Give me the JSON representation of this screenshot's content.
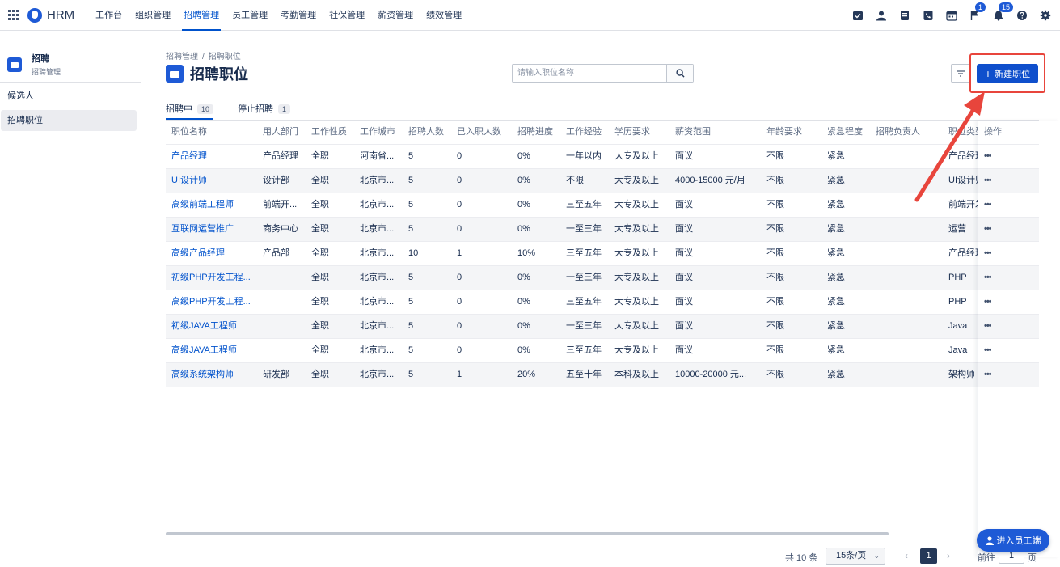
{
  "app": {
    "name": "HRM"
  },
  "nav": {
    "items": [
      "工作台",
      "组织管理",
      "招聘管理",
      "员工管理",
      "考勤管理",
      "社保管理",
      "薪资管理",
      "绩效管理"
    ],
    "active": "招聘管理"
  },
  "top_icons": [
    {
      "name": "task-icon"
    },
    {
      "name": "user-icon"
    },
    {
      "name": "document-icon"
    },
    {
      "name": "phone-icon"
    },
    {
      "name": "calendar-icon"
    },
    {
      "name": "flag-icon",
      "badge": "1"
    },
    {
      "name": "bell-icon",
      "badge": "15"
    },
    {
      "name": "help-icon"
    },
    {
      "name": "settings-icon"
    }
  ],
  "sidebar": {
    "title": "招聘",
    "subtitle": "招聘管理",
    "items": [
      {
        "label": "候选人",
        "active": false
      },
      {
        "label": "招聘职位",
        "active": true
      }
    ]
  },
  "breadcrumb": [
    "招聘管理",
    "招聘职位"
  ],
  "page_title": "招聘职位",
  "search": {
    "placeholder": "请输入职位名称",
    "value": ""
  },
  "new_button": "新建职位",
  "tabs": [
    {
      "label": "招聘中",
      "count": "10",
      "active": true
    },
    {
      "label": "停止招聘",
      "count": "1",
      "active": false
    }
  ],
  "table": {
    "columns": [
      "职位名称",
      "用人部门",
      "工作性质",
      "工作城市",
      "招聘人数",
      "已入职人数",
      "招聘进度",
      "工作经验",
      "学历要求",
      "薪资范围",
      "年龄要求",
      "紧急程度",
      "招聘负责人",
      "职位类型",
      "操作"
    ],
    "rows": [
      [
        "产品经理",
        "产品经理",
        "全职",
        "河南省...",
        "5",
        "0",
        "0%",
        "一年以内",
        "大专及以上",
        "面议",
        "不限",
        "紧急",
        "",
        "产品经理"
      ],
      [
        "UI设计师",
        "设计部",
        "全职",
        "北京市...",
        "5",
        "0",
        "0%",
        "不限",
        "大专及以上",
        "4000-15000 元/月",
        "不限",
        "紧急",
        "",
        "UI设计师"
      ],
      [
        "高级前端工程师",
        "前端开...",
        "全职",
        "北京市...",
        "5",
        "0",
        "0%",
        "三至五年",
        "大专及以上",
        "面议",
        "不限",
        "紧急",
        "",
        "前端开发"
      ],
      [
        "互联网运营推广",
        "商务中心",
        "全职",
        "北京市...",
        "5",
        "0",
        "0%",
        "一至三年",
        "大专及以上",
        "面议",
        "不限",
        "紧急",
        "",
        "运营"
      ],
      [
        "高级产品经理",
        "产品部",
        "全职",
        "北京市...",
        "10",
        "1",
        "10%",
        "三至五年",
        "大专及以上",
        "面议",
        "不限",
        "紧急",
        "",
        "产品经理"
      ],
      [
        "初级PHP开发工程...",
        "",
        "全职",
        "北京市...",
        "5",
        "0",
        "0%",
        "一至三年",
        "大专及以上",
        "面议",
        "不限",
        "紧急",
        "",
        "PHP"
      ],
      [
        "高级PHP开发工程...",
        "",
        "全职",
        "北京市...",
        "5",
        "0",
        "0%",
        "三至五年",
        "大专及以上",
        "面议",
        "不限",
        "紧急",
        "",
        "PHP"
      ],
      [
        "初级JAVA工程师",
        "",
        "全职",
        "北京市...",
        "5",
        "0",
        "0%",
        "一至三年",
        "大专及以上",
        "面议",
        "不限",
        "紧急",
        "",
        "Java"
      ],
      [
        "高级JAVA工程师",
        "",
        "全职",
        "北京市...",
        "5",
        "0",
        "0%",
        "三至五年",
        "大专及以上",
        "面议",
        "不限",
        "紧急",
        "",
        "Java"
      ],
      [
        "高级系统架构师",
        "研发部",
        "全职",
        "北京市...",
        "5",
        "1",
        "20%",
        "五至十年",
        "本科及以上",
        "10000-20000 元...",
        "不限",
        "紧急",
        "",
        "架构师"
      ]
    ],
    "row_action": "•••"
  },
  "pagination": {
    "total": "共 10 条",
    "page_size": "15条/页",
    "current_page": "1",
    "goto_label": "前往",
    "goto_value": "1",
    "goto_suffix": "页"
  },
  "employee_portal_button": "进入员工端",
  "colors": {
    "primary": "#0f4fcc",
    "highlight": "#e8453c"
  }
}
